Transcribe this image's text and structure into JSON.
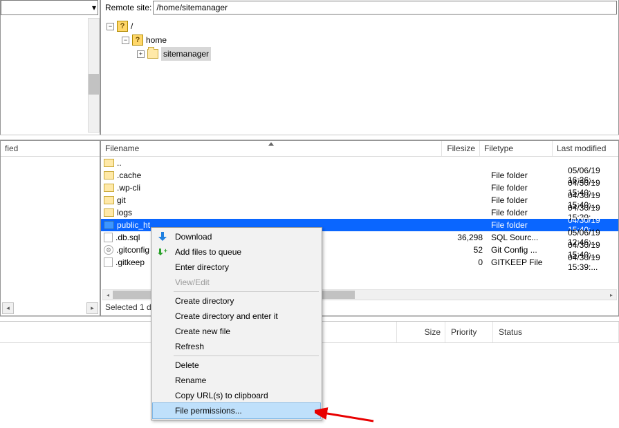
{
  "remote": {
    "label": "Remote site:",
    "path": "/home/sitemanager"
  },
  "tree": {
    "root": "/",
    "home": "home",
    "site": "sitemanager"
  },
  "left": {
    "header_suffix": "fied"
  },
  "columns": {
    "name": "Filename",
    "size": "Filesize",
    "type": "Filetype",
    "mod": "Last modified"
  },
  "files": [
    {
      "icon": "folder",
      "name": "..",
      "size": "",
      "type": "",
      "mod": ""
    },
    {
      "icon": "folder",
      "name": ".cache",
      "size": "",
      "type": "File folder",
      "mod": "05/06/19 16:26:..."
    },
    {
      "icon": "folder",
      "name": ".wp-cli",
      "size": "",
      "type": "File folder",
      "mod": "04/30/19 15:40:..."
    },
    {
      "icon": "folder",
      "name": "git",
      "size": "",
      "type": "File folder",
      "mod": "04/30/19 15:40:..."
    },
    {
      "icon": "folder",
      "name": "logs",
      "size": "",
      "type": "File folder",
      "mod": "04/30/19 15:39:..."
    },
    {
      "icon": "folder",
      "name": "public_ht",
      "size": "",
      "type": "File folder",
      "mod": "04/30/19 15:40:...",
      "selected": true
    },
    {
      "icon": "file",
      "name": ".db.sql",
      "size": "36,298",
      "type": "SQL Sourc...",
      "mod": "05/06/19 12:46:..."
    },
    {
      "icon": "gear",
      "name": ".gitconfig",
      "size": "52",
      "type": "Git Config ...",
      "mod": "04/30/19 15:40:..."
    },
    {
      "icon": "file",
      "name": ".gitkeep",
      "size": "0",
      "type": "GITKEEP File",
      "mod": "04/30/19 15:39:..."
    }
  ],
  "status": "Selected 1 di",
  "queue_columns": {
    "size": "Size",
    "priority": "Priority",
    "status": "Status"
  },
  "context_menu": {
    "download": "Download",
    "add_queue": "Add files to queue",
    "enter_dir": "Enter directory",
    "view_edit": "View/Edit",
    "create_dir": "Create directory",
    "create_dir_enter": "Create directory and enter it",
    "create_file": "Create new file",
    "refresh": "Refresh",
    "delete": "Delete",
    "rename": "Rename",
    "copy_urls": "Copy URL(s) to clipboard",
    "file_perms": "File permissions..."
  }
}
